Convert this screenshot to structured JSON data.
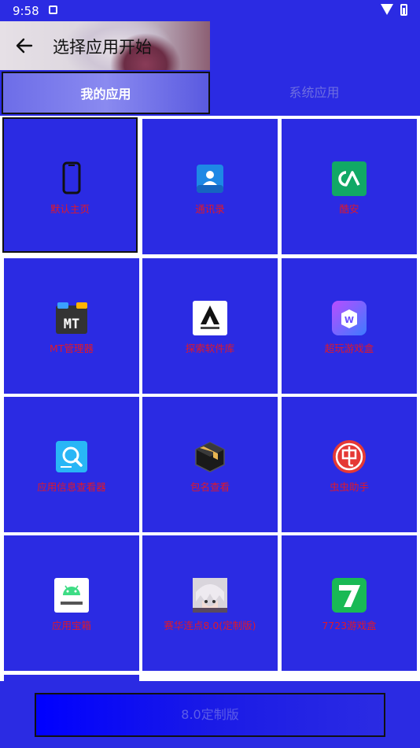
{
  "status_bar": {
    "time": "9:58"
  },
  "header": {
    "title": "选择应用开始"
  },
  "tabs": [
    {
      "label": "我的应用"
    },
    {
      "label": "系统应用"
    }
  ],
  "apps": [
    {
      "label": "默认主页"
    },
    {
      "label": "通讯录"
    },
    {
      "label": "酷安"
    },
    {
      "label": "MT管理器"
    },
    {
      "label": "探索软件库"
    },
    {
      "label": "超玩游戏盒"
    },
    {
      "label": "应用信息查看器"
    },
    {
      "label": "包名查看"
    },
    {
      "label": "虫虫助手"
    },
    {
      "label": "应用宝箱"
    },
    {
      "label": "赛华连点8.0(定制版)"
    },
    {
      "label": "7723游戏盒"
    }
  ],
  "footer": {
    "version_label": "8.0定制版"
  },
  "colors": {
    "primary": "#2b2be3",
    "label_red": "#e0182a"
  }
}
